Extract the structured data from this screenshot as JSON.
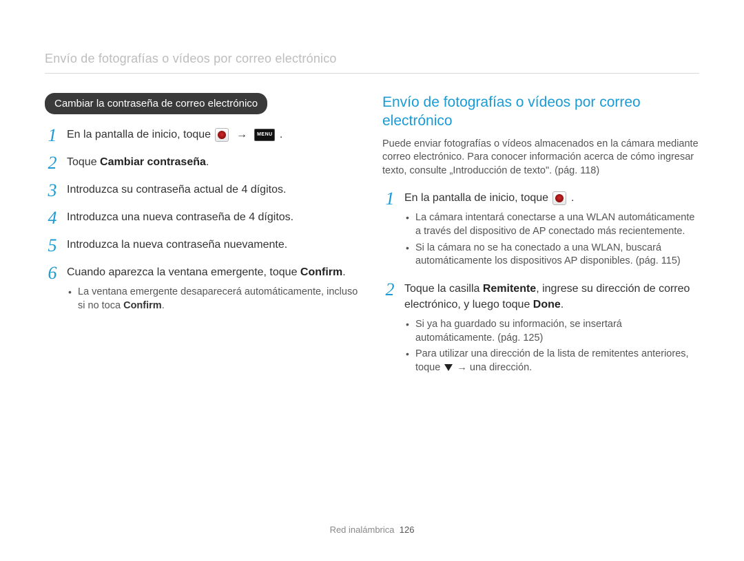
{
  "header": {
    "title": "Envío de fotografías o vídeos por correo electrónico"
  },
  "left": {
    "pill": "Cambiar la contraseña de correo electrónico",
    "steps": {
      "s1_a": "En la pantalla de inicio, toque ",
      "s1_b": ".",
      "s2_a": "Toque ",
      "s2_bold": "Cambiar contraseña",
      "s2_b": ".",
      "s3": "Introduzca su contraseña actual de 4 dígitos.",
      "s4": "Introduzca una nueva contraseña de 4 dígitos.",
      "s5": "Introduzca la nueva contraseña nuevamente.",
      "s6_a": "Cuando aparezca la ventana emergente, toque ",
      "s6_bold": "Confirm",
      "s6_b": ".",
      "s6_sub_a": "La ventana emergente desaparecerá automáticamente, incluso si no toca ",
      "s6_sub_bold": "Confirm",
      "s6_sub_b": "."
    }
  },
  "right": {
    "title": "Envío de fotografías o vídeos por correo electrónico",
    "intro": "Puede enviar fotografías o vídeos almacenados en la cámara mediante correo electrónico. Para conocer información acerca de cómo ingresar texto, consulte „Introducción de texto\". (pág. 118)",
    "steps": {
      "s1_a": "En la pantalla de inicio, toque ",
      "s1_b": ".",
      "s1_sub1": "La cámara intentará conectarse a una WLAN automáticamente a través del dispositivo de AP conectado más recientemente.",
      "s1_sub2": "Si la cámara no se ha conectado a una WLAN, buscará automáticamente los dispositivos AP disponibles. (pág. 115)",
      "s2_a": "Toque la casilla ",
      "s2_bold1": "Remitente",
      "s2_b": ", ingrese su dirección de correo electrónico, y luego toque ",
      "s2_bold2": "Done",
      "s2_c": ".",
      "s2_sub1": "Si ya ha guardado su información, se insertará automáticamente. (pág. 125)",
      "s2_sub2_a": "Para utilizar una dirección de la lista de remitentes anteriores, toque ",
      "s2_sub2_b": " → una dirección."
    }
  },
  "footer": {
    "section": "Red inalámbrica",
    "page": "126"
  }
}
